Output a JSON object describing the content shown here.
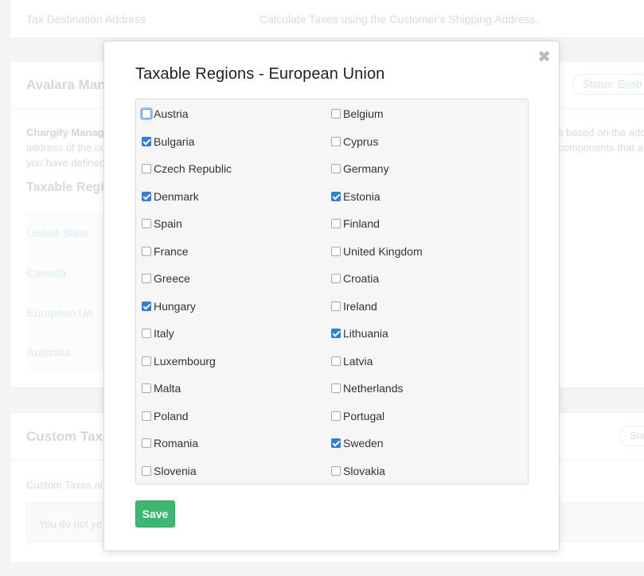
{
  "background": {
    "tax_destination": {
      "label": "Tax Destination Address",
      "value": "Calculate Taxes using the Customer's Shipping Address."
    },
    "avalara": {
      "title": "Avalara Mana",
      "status_label": "Status:",
      "status_value": "Enab",
      "desc_bold": "Chargify Manag",
      "desc_line1_rest": "",
      "desc_line1_right": "s based on the add",
      "desc_line2": "address of the cu",
      "desc_line2_right": "components that a",
      "desc_line3": "you have defined",
      "subheading": "Taxable Regio",
      "regions": [
        "United State",
        "Canada",
        "European Un",
        "Australia"
      ]
    },
    "custom_taxes": {
      "title": "Custom Taxes",
      "status_label": "Sta",
      "desc": "Custom Taxes al",
      "empty": "You do not ye"
    }
  },
  "modal": {
    "title": "Taxable Regions - European Union",
    "close_glyph": "✖",
    "save_label": "Save",
    "regions": [
      {
        "name": "Austria",
        "checked": false,
        "focused": true
      },
      {
        "name": "Belgium",
        "checked": false
      },
      {
        "name": "Bulgaria",
        "checked": true
      },
      {
        "name": "Cyprus",
        "checked": false
      },
      {
        "name": "Czech Republic",
        "checked": false
      },
      {
        "name": "Germany",
        "checked": false
      },
      {
        "name": "Denmark",
        "checked": true
      },
      {
        "name": "Estonia",
        "checked": true
      },
      {
        "name": "Spain",
        "checked": false
      },
      {
        "name": "Finland",
        "checked": false
      },
      {
        "name": "France",
        "checked": false
      },
      {
        "name": "United Kingdom",
        "checked": false
      },
      {
        "name": "Greece",
        "checked": false
      },
      {
        "name": "Croatia",
        "checked": false
      },
      {
        "name": "Hungary",
        "checked": true
      },
      {
        "name": "Ireland",
        "checked": false
      },
      {
        "name": "Italy",
        "checked": false
      },
      {
        "name": "Lithuania",
        "checked": true
      },
      {
        "name": "Luxembourg",
        "checked": false
      },
      {
        "name": "Latvia",
        "checked": false
      },
      {
        "name": "Malta",
        "checked": false
      },
      {
        "name": "Netherlands",
        "checked": false
      },
      {
        "name": "Poland",
        "checked": false
      },
      {
        "name": "Portugal",
        "checked": false
      },
      {
        "name": "Romania",
        "checked": false
      },
      {
        "name": "Sweden",
        "checked": true
      },
      {
        "name": "Slovenia",
        "checked": false
      },
      {
        "name": "Slovakia",
        "checked": false
      }
    ]
  },
  "colors": {
    "accent_checkbox": "#2f7de0",
    "save_button": "#3bb870",
    "link_region": "#c7e0f0"
  }
}
